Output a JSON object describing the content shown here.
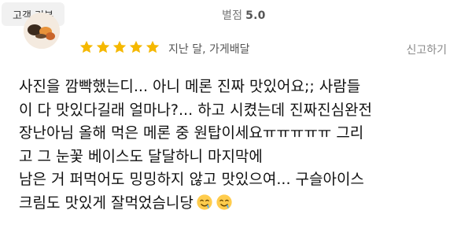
{
  "header": {
    "badge_label": "고객 리뷰",
    "rating_label": "별점",
    "rating_value": "5.0"
  },
  "review": {
    "rating": 5,
    "rating_max": 5,
    "meta": "지난 달, 가게배달",
    "report_label": "신고하기",
    "text_lines": [
      "사진을 깜빡했는디... 아니 메론 진짜 맛있어요;; 사람들",
      "이 다 맛있다길래 얼마나?... 하고 시켰는데 진짜진심완전",
      "장난아님 올해 먹은 메론 중 원탑이세요ㅠㅠㅠㅠㅠ 그리",
      "고 그 눈꽃 베이스도 달달하니 마지막에",
      "남은 거 퍼먹어도 밍밍하지 않고 맛있으여... 구슬아이스",
      "크림도 맛있게 잘먹었슴니당"
    ],
    "emojis": [
      "drooling-face-icon",
      "drooling-face-icon"
    ]
  },
  "colors": {
    "star": "#f5b800",
    "badge_bg": "#f1f1f1",
    "text": "#111111",
    "muted": "#8a8a8a"
  }
}
